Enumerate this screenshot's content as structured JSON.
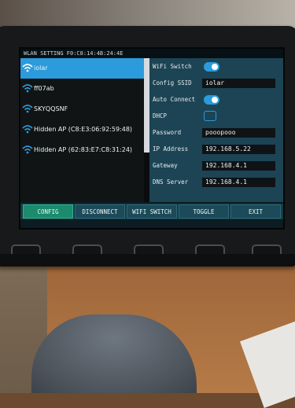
{
  "title_bar": "WLAN SETTING F0:C8:14:4B:24:4E",
  "ap_list": [
    {
      "name": "iolar",
      "selected": true
    },
    {
      "name": "ff07ab",
      "selected": false
    },
    {
      "name": "SKYQQSNF",
      "selected": false
    },
    {
      "name": "Hidden AP (C8:E3:06:92:59:48)",
      "selected": false
    },
    {
      "name": "Hidden AP (62:83:E7:C8:31:24)",
      "selected": false
    }
  ],
  "settings": {
    "wifi_switch_label": "WiFi Switch",
    "config_ssid_label": "Config SSID",
    "config_ssid_value": "iolar",
    "auto_connect_label": "Auto Connect",
    "dhcp_label": "DHCP",
    "password_label": "Password",
    "password_value": "pooopooo",
    "ip_address_label": "IP Address",
    "ip_address_value": "192.168.5.22",
    "gateway_label": "Gateway",
    "gateway_value": "192.168.4.1",
    "dns_server_label": "DNS Server",
    "dns_server_value": "192.168.4.1"
  },
  "menu": {
    "config": "CONFIG",
    "disconnect": "DISCONNECT",
    "wifi_switch": "WIFI SWITCH",
    "toggle": "TOGGLE",
    "exit": "EXIT"
  },
  "colors": {
    "accent": "#2b9bdc",
    "menu_active": "#1c8a6c"
  }
}
